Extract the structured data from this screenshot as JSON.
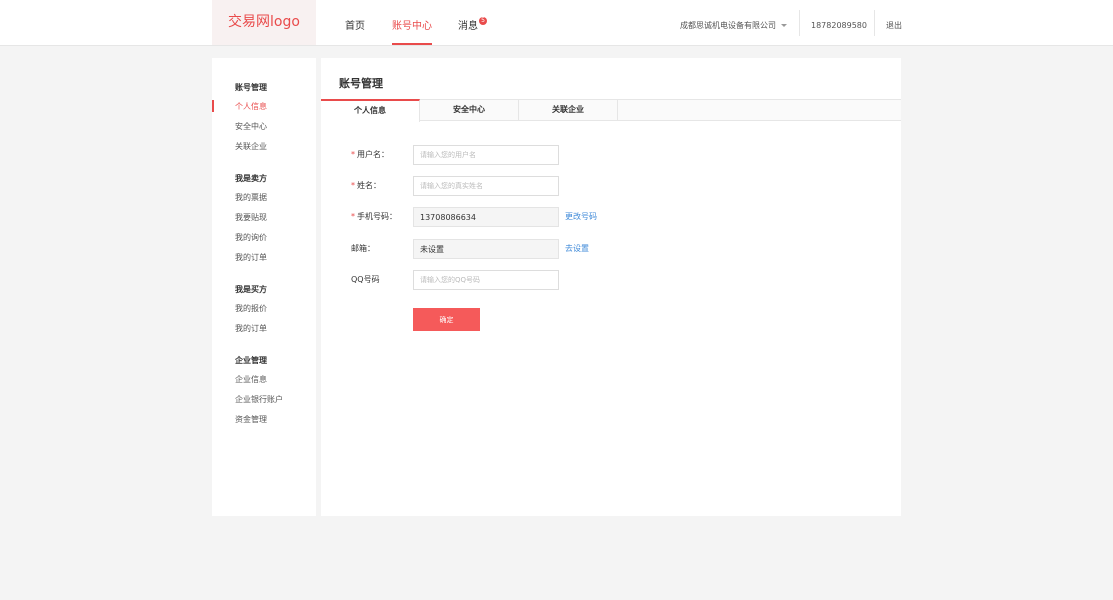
{
  "header": {
    "logo": "交易网logo",
    "nav": [
      {
        "label": "首页"
      },
      {
        "label": "账号中心"
      },
      {
        "label": "消息"
      }
    ],
    "message_badge": "5",
    "company": "成都思诚机电设备有限公司",
    "phone": "18782089580",
    "logout": "退出"
  },
  "sidebar": {
    "groups": [
      {
        "title": "账号管理",
        "items": [
          "个人信息",
          "安全中心",
          "关联企业"
        ]
      },
      {
        "title": "我是卖方",
        "items": [
          "我的票据",
          "我要贴现",
          "我的询价",
          "我的订单"
        ]
      },
      {
        "title": "我是买方",
        "items": [
          "我的报价",
          "我的订单"
        ]
      },
      {
        "title": "企业管理",
        "items": [
          "企业信息",
          "企业银行账户",
          "资金管理"
        ]
      }
    ]
  },
  "main": {
    "title": "账号管理",
    "tabs": [
      {
        "label": "个人信息"
      },
      {
        "label": "安全中心"
      },
      {
        "label": "关联企业"
      }
    ],
    "form": {
      "username": {
        "label": "用户名：",
        "placeholder": "请输入您的用户名",
        "value": ""
      },
      "name": {
        "label": "姓名：",
        "placeholder": "请输入您的真实姓名",
        "value": ""
      },
      "mobile": {
        "label": "手机号码：",
        "value": "13708086634",
        "link": "更改号码"
      },
      "email": {
        "label": "邮箱：",
        "value": "未设置",
        "link": "去设置"
      },
      "qq": {
        "label": "QQ号码",
        "placeholder": "请输入您的QQ号码",
        "value": ""
      },
      "required_mark": "*",
      "confirm": "确定"
    }
  },
  "colors": {
    "accent": "#e94b4b",
    "link": "#3f8ad9",
    "button": "#f55a5a",
    "background": "#f4f4f4"
  }
}
